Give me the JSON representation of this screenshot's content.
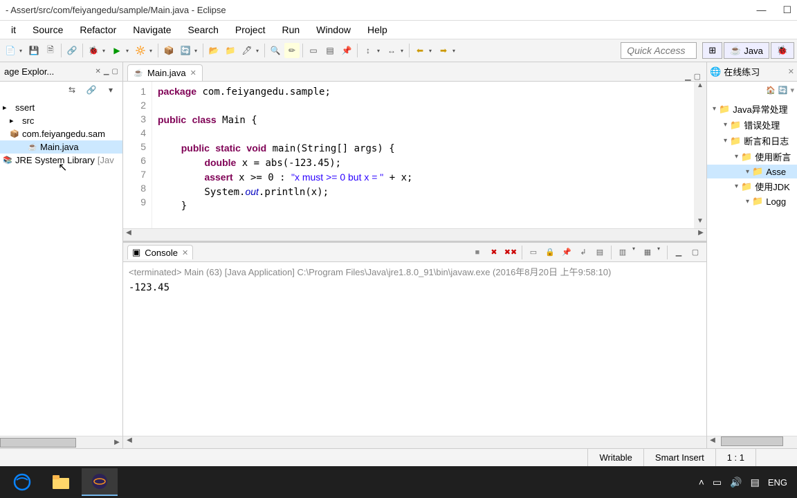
{
  "title": "- Assert/src/com/feiyangedu/sample/Main.java - Eclipse",
  "menu": [
    "it",
    "Source",
    "Refactor",
    "Navigate",
    "Search",
    "Project",
    "Run",
    "Window",
    "Help"
  ],
  "quick_access": "Quick Access",
  "perspective": "Java",
  "left_panel": {
    "title": "age Explor...",
    "items": [
      {
        "label": "ssert",
        "indent": 0
      },
      {
        "label": "src",
        "indent": 1
      },
      {
        "label": "com.feiyangedu.sam",
        "indent": 1,
        "pkg": true
      },
      {
        "label": "Main.java",
        "indent": 3,
        "file": true,
        "selected": true
      },
      {
        "label": "JRE System Library",
        "suffix": "[Jav",
        "indent": 0,
        "lib": true
      }
    ]
  },
  "editor": {
    "tab": "Main.java",
    "lines": [
      1,
      2,
      3,
      4,
      5,
      6,
      7,
      8,
      9
    ],
    "code_html": "<span class='kw'>package</span> com.feiyangedu.sample;\n\n<span class='kw'>public</span> <span class='kw'>class</span> Main {\n\n    <span class='kw'>public</span> <span class='kw'>static</span> <span class='kw'>void</span> main(String[] args) {\n        <span class='kw'>double</span> x = abs(-123.45);\n        <span class='kw'>assert</span> x >= 0 : <span class='str'>\"x must >= 0 but x = \"</span> + x;\n        System.<span class='fld'>out</span>.println(x);\n    }"
  },
  "console": {
    "tab": "Console",
    "header": "<terminated> Main (63) [Java Application] C:\\Program Files\\Java\\jre1.8.0_91\\bin\\javaw.exe (2016年8月20日 上午9:58:10)",
    "output": "-123.45"
  },
  "right_panel": {
    "title": "在线练习",
    "items": [
      {
        "label": "Java异常处理",
        "indent": 1
      },
      {
        "label": "错误处理",
        "indent": 2
      },
      {
        "label": "断言和日志",
        "indent": 2
      },
      {
        "label": "使用断言",
        "indent": 3
      },
      {
        "label": "Asse",
        "indent": 4,
        "selected": true
      },
      {
        "label": "使用JDK",
        "indent": 3
      },
      {
        "label": "Logg",
        "indent": 4
      }
    ]
  },
  "status": {
    "writable": "Writable",
    "insert": "Smart Insert",
    "pos": "1 : 1"
  },
  "tray": {
    "lang": "ENG"
  }
}
